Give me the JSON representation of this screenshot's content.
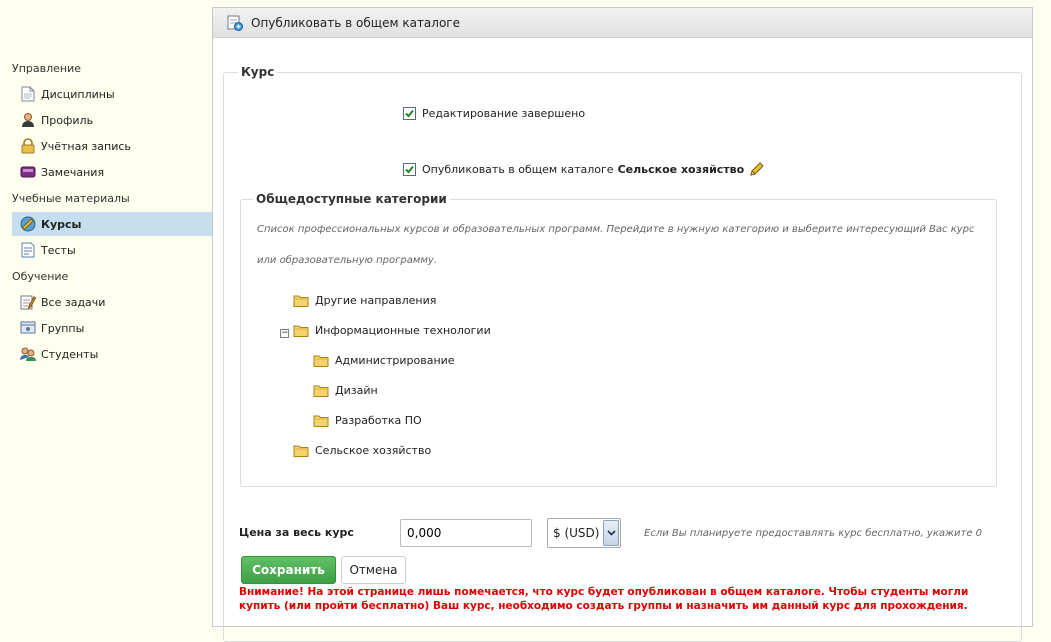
{
  "sidebar": {
    "sections": [
      {
        "title": "Управление",
        "items": [
          {
            "label": "Дисциплины",
            "icon": "document-icon"
          },
          {
            "label": "Профиль",
            "icon": "user-icon"
          },
          {
            "label": "Учётная запись",
            "icon": "lock-icon"
          },
          {
            "label": "Замечания",
            "icon": "comments-icon"
          }
        ]
      },
      {
        "title": "Учебные материалы",
        "items": [
          {
            "label": "Курсы",
            "icon": "course-icon",
            "active": true
          },
          {
            "label": "Тесты",
            "icon": "test-icon"
          }
        ]
      },
      {
        "title": "Обучение",
        "items": [
          {
            "label": "Все задачи",
            "icon": "tasks-icon"
          },
          {
            "label": "Группы",
            "icon": "groups-icon"
          },
          {
            "label": "Студенты",
            "icon": "students-icon"
          }
        ]
      }
    ]
  },
  "header": {
    "title": "Опубликовать в общем каталоге"
  },
  "course": {
    "legend": "Курс",
    "edit_done_label": "Редактирование завершено",
    "edit_done_checked": true,
    "publish_label": "Опубликовать в общем каталоге",
    "publish_category": "Сельское хозяйство",
    "publish_checked": true
  },
  "categories": {
    "legend": "Общедоступные категории",
    "description_line1": "Список профессиональных курсов и образовательных программ. Перейдите в нужную категорию и выберите интересующий Вас курс",
    "description_line2": "или образовательную программу.",
    "tree": [
      "Другие направления",
      "Информационные технологии",
      "Администрирование",
      "Дизайн",
      "Разработка ПО",
      "Сельское хозяйство"
    ]
  },
  "price": {
    "label": "Цена за весь курс",
    "value": "0,000",
    "currency": "$ (USD)",
    "hint": "Если Вы планируете предоставлять курс бесплатно, укажите 0"
  },
  "actions": {
    "save_label": "Сохранить",
    "cancel_label": "Отмена"
  },
  "warning": "Внимание! На этой странице лишь помечается, что курс будет опубликован в общем каталоге. Чтобы студенты могли купить (или пройти бесплатно) Ваш курс, необходимо создать группы и назначить им данный курс для прохождения.",
  "colors": {
    "active_bg": "#c5dfee",
    "save_green": "#4caf50",
    "warning_red": "#e00000",
    "sidebar_bg": "#fffff0"
  }
}
